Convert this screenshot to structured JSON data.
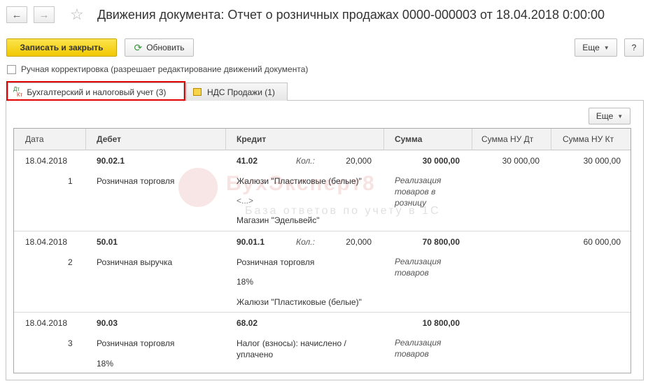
{
  "window": {
    "title": "Движения документа: Отчет о розничных продажах 0000-000003 от 18.04.2018 0:00:00"
  },
  "nav": {
    "back_label": "←",
    "forward_label": "→",
    "star_label": "☆"
  },
  "toolbar": {
    "save_close_label": "Записать и закрыть",
    "refresh_label": "Обновить",
    "more_label": "Еще",
    "help_label": "?"
  },
  "manual_edit": {
    "label": "Ручная корректировка (разрешает редактирование движений документа)",
    "checked": false
  },
  "tabs": [
    {
      "label": "Бухгалтерский и налоговый учет (3)",
      "icon": "dt-kt-icon",
      "active": true
    },
    {
      "label": "НДС Продажи (1)",
      "icon": "register-icon",
      "active": false
    }
  ],
  "dtkt_icon": {
    "dt": "Дт",
    "kt": "Кт"
  },
  "panel_more_label": "Еще",
  "table": {
    "columns": [
      "Дата",
      "Дебет",
      "Кредит",
      "Сумма",
      "Сумма НУ Дт",
      "Сумма НУ Кт"
    ],
    "qty_label": "Кол.:",
    "rows": [
      {
        "date": "18.04.2018",
        "number": "1",
        "debit_account": "90.02.1",
        "debit_sub": [
          "Розничная торговля"
        ],
        "credit_account": "41.02",
        "qty": "20,000",
        "credit_sub": [
          "Жалюзи \"Пластиковые (белые)\"",
          "<...>",
          "Магазин \"Эдельвейс\""
        ],
        "amount": "30 000,00",
        "content": "Реализация товаров в розницу",
        "nu_dt": "30 000,00",
        "nu_kt": "30 000,00"
      },
      {
        "date": "18.04.2018",
        "number": "2",
        "debit_account": "50.01",
        "debit_sub": [
          "Розничная выручка"
        ],
        "credit_account": "90.01.1",
        "qty": "20,000",
        "credit_sub": [
          "Розничная торговля",
          "18%",
          "Жалюзи \"Пластиковые (белые)\""
        ],
        "amount": "70 800,00",
        "content": "Реализация товаров",
        "nu_dt": "",
        "nu_kt": "60 000,00"
      },
      {
        "date": "18.04.2018",
        "number": "3",
        "debit_account": "90.03",
        "debit_sub": [
          "Розничная торговля",
          "18%"
        ],
        "credit_account": "68.02",
        "qty": "",
        "credit_sub": [
          "Налог (взносы): начислено /",
          "уплачено"
        ],
        "amount": "10 800,00",
        "content": "Реализация товаров",
        "nu_dt": "",
        "nu_kt": ""
      }
    ]
  },
  "watermark": {
    "brand": "БухЭксперт8",
    "tagline": "База ответов по учету в 1С"
  },
  "colors": {
    "primary_button": "#f1c800",
    "tab_highlight": "#e00000",
    "refresh_icon": "#3a9a3a"
  }
}
